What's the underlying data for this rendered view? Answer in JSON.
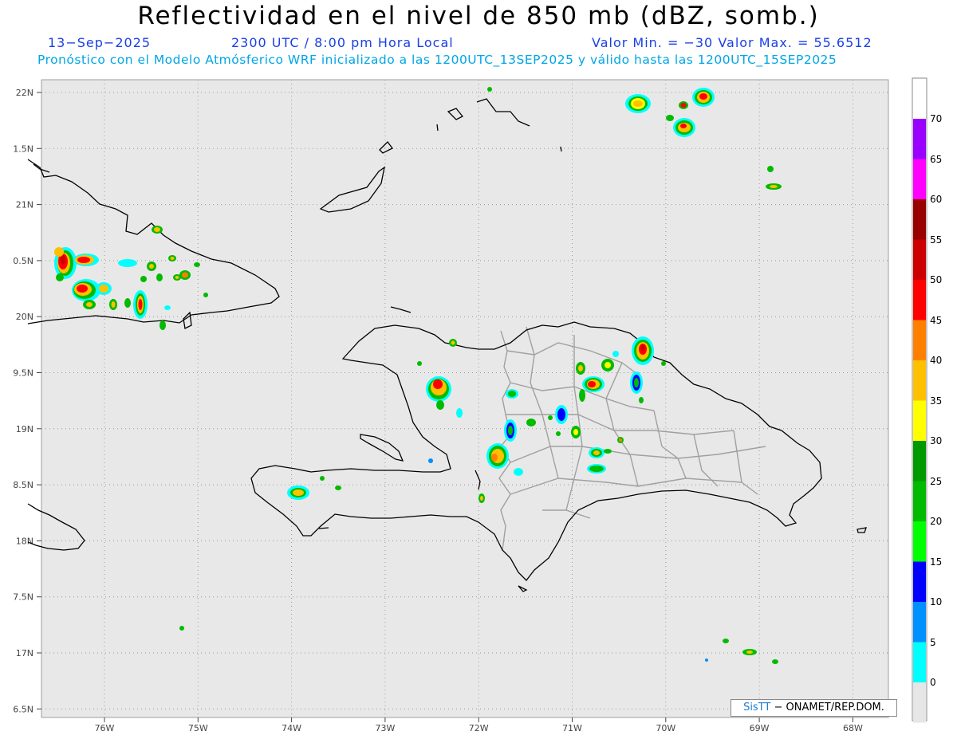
{
  "header": {
    "title": "Reflectividad en el nivel de 850 mb (dBZ, somb.)",
    "date": "13−Sep−2025",
    "time": "2300 UTC / 8:00 pm Hora Local",
    "min_max": "Valor Min. = −30  Valor Max. = 55.6512",
    "forecast": "Pronóstico con el Modelo Atmósferico WRF inicializado a las 1200UTC_13SEP2025 y válido hasta las  1200UTC_15SEP2025"
  },
  "map": {
    "lat_labels": [
      "22N",
      "1.5N",
      "21N",
      "0.5N",
      "20N",
      "9.5N",
      "19N",
      "8.5N",
      "18N",
      "7.5N",
      "17N",
      "6.5N"
    ],
    "lon_labels": [
      "76W",
      "75W",
      "74W",
      "73W",
      "72W",
      "71W",
      "70W",
      "69W",
      "68W"
    ],
    "background_color": "#e8e8e8",
    "coast_color": "#000000",
    "border_color": "#a0a0a0"
  },
  "colorbar": {
    "labels": [
      "70",
      "65",
      "60",
      "55",
      "50",
      "45",
      "40",
      "35",
      "30",
      "25",
      "20",
      "15",
      "10",
      "5",
      "0"
    ],
    "colors": [
      "#9900ff",
      "#ff00ff",
      "#990000",
      "#cc0000",
      "#ff0000",
      "#ff8000",
      "#ffc000",
      "#ffff00",
      "#009900",
      "#00bb00",
      "#00ff00",
      "#0000ff",
      "#0090ff",
      "#00ffff",
      "#e6e6e6"
    ]
  },
  "credit": {
    "brand": "SisTT",
    "text": "− ONAMET/REP.DOM."
  }
}
